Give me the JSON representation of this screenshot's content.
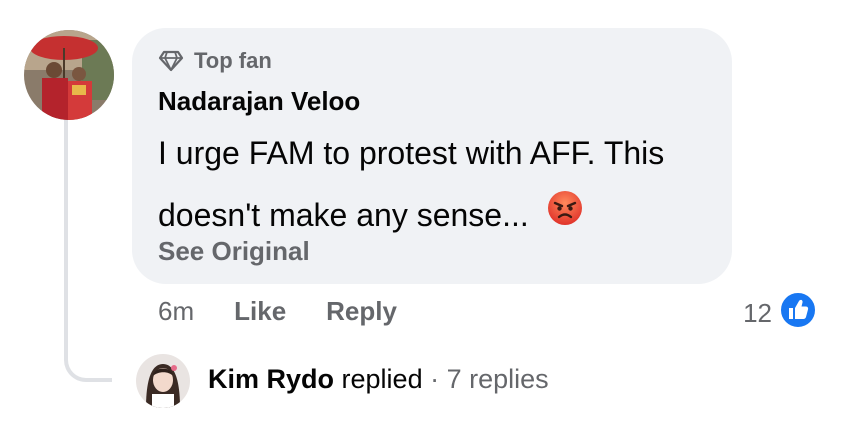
{
  "comment": {
    "badge_label": "Top fan",
    "badge_icon": "diamond-icon",
    "author": "Nadarajan Veloo",
    "text_line1": "I urge FAM to protest with AFF. This",
    "text_line2": "doesn't make any sense...",
    "emoji": "angry-face-emoji",
    "see_original": "See Original",
    "time": "6m",
    "like_label": "Like",
    "reply_label": "Reply",
    "reaction_count": "12",
    "reaction_icon": "thumbs-up-icon"
  },
  "reply_summary": {
    "name": "Kim Rydo",
    "action": "replied",
    "separator": "·",
    "count": "7 replies"
  },
  "colors": {
    "bubble_bg": "#f0f2f5",
    "secondary_text": "#65676b",
    "primary_text": "#050505",
    "like_blue": "#1877f2",
    "thread_line": "#dfe1e5"
  }
}
